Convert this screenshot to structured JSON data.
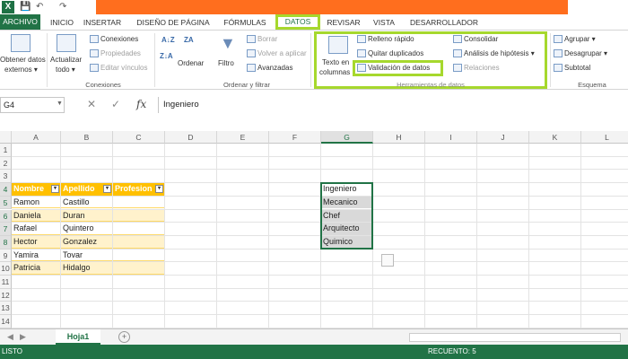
{
  "window": {
    "app_logo": "X",
    "qa_save": "💾",
    "qa_undo": "↶",
    "qa_redo": "↷"
  },
  "tabs": [
    "ARCHIVO",
    "INICIO",
    "INSERTAR",
    "DISEÑO DE PÁGINA",
    "FÓRMULAS",
    "DATOS",
    "REVISAR",
    "VISTA",
    "DESARROLLADOR"
  ],
  "ribbon": {
    "get_external": [
      "Obtener datos",
      "externos ▾"
    ],
    "refresh_all": [
      "Actualizar",
      "todo ▾"
    ],
    "connections": "Conexiones",
    "properties": "Propiedades",
    "edit_links": "Editar vínculos",
    "group_connections": "Conexiones",
    "sort": "Ordenar",
    "filter": "Filtro",
    "clear": "Borrar",
    "reapply": "Volver a aplicar",
    "advanced": "Avanzadas",
    "group_sort_filter": "Ordenar y filtrar",
    "text_to_columns": [
      "Texto en",
      "columnas"
    ],
    "flash_fill": "Relleno rápido",
    "remove_duplicates": "Quitar duplicados",
    "data_validation": "Validación de datos",
    "consolidate": "Consolidar",
    "what_if": "Análisis de hipótesis ▾",
    "relationships": "Relaciones",
    "group_data_tools": "Herramientas de datos",
    "group": "Agrupar ▾",
    "ungroup": "Desagrupar ▾",
    "subtotal": "Subtotal",
    "group_outline": "Esquema"
  },
  "formula_bar": {
    "name_box": "G4",
    "fx": "fx",
    "cancel": "✕",
    "enter": "✓",
    "value": "Ingeniero"
  },
  "columns": [
    "A",
    "B",
    "C",
    "D",
    "E",
    "F",
    "G",
    "H",
    "I",
    "J",
    "K",
    "L"
  ],
  "rows": [
    "1",
    "2",
    "3",
    "4",
    "5",
    "6",
    "7",
    "8",
    "9",
    "10",
    "11",
    "12",
    "13",
    "14"
  ],
  "table": {
    "headers": [
      "Nombre",
      "Apellido",
      "Profesion"
    ],
    "rows": [
      [
        "Ramon",
        "Castillo",
        ""
      ],
      [
        "Daniela",
        "Duran",
        ""
      ],
      [
        "Rafael",
        "Quintero",
        ""
      ],
      [
        "Hector",
        "Gonzalez",
        ""
      ],
      [
        "Yamira",
        "Tovar",
        ""
      ],
      [
        "Patricia",
        "Hidalgo",
        ""
      ]
    ]
  },
  "list_g": [
    "Ingeniero",
    "Mecanico",
    "Chef",
    "Arquitecto",
    "Quimico"
  ],
  "sheet_tab": "Hoja1",
  "add_sheet": "+",
  "status": {
    "mode": "LISTO",
    "count": "RECUENTO: 5"
  },
  "colors": {
    "accent": "#217346",
    "highlight": "#a6d82d",
    "banner": "#ff6e1e",
    "table_header": "#ffc000",
    "table_band": "#fff2cc"
  }
}
